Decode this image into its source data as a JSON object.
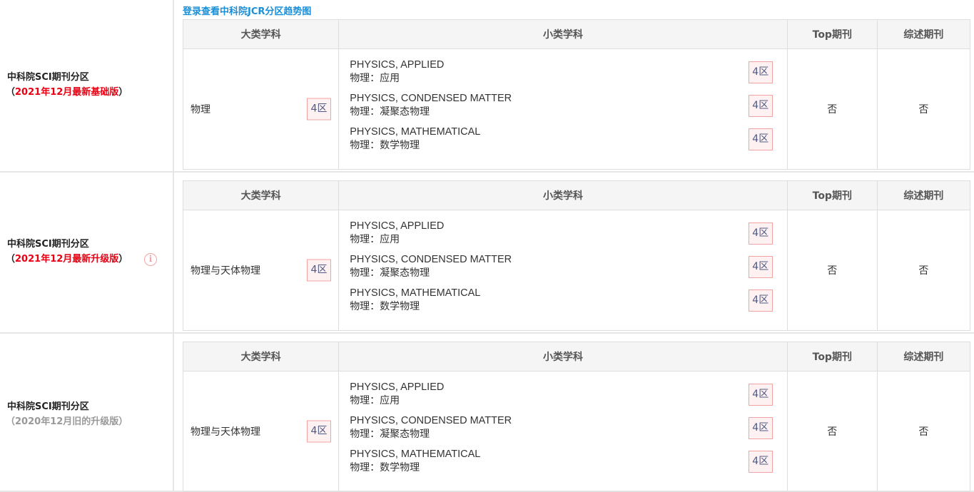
{
  "login_link": "登录查看中科院JCR分区趋势图",
  "headers": {
    "big_category": "大类学科",
    "small_category": "小类学科",
    "top": "Top期刊",
    "review": "综述期刊"
  },
  "sections": [
    {
      "title": "中科院SCI期刊分区",
      "paren_open": "（",
      "version": "2021年12月最新基础版",
      "paren_close": "）",
      "version_color": "red",
      "big_category": "物理",
      "big_zone": "4区",
      "subcategories": [
        {
          "en": "PHYSICS, APPLIED",
          "cn": "物理：应用",
          "zone": "4区"
        },
        {
          "en": "PHYSICS, CONDENSED MATTER",
          "cn": "物理：凝聚态物理",
          "zone": "4区"
        },
        {
          "en": "PHYSICS, MATHEMATICAL",
          "cn": "物理：数学物理",
          "zone": "4区"
        }
      ],
      "top": "否",
      "review": "否"
    },
    {
      "title": "中科院SCI期刊分区",
      "paren_open": "（",
      "version": "2021年12月最新升级版",
      "paren_close": "）",
      "version_color": "red",
      "info_icon": "info-circle-icon",
      "big_category": "物理与天体物理",
      "big_zone": "4区",
      "subcategories": [
        {
          "en": "PHYSICS, APPLIED",
          "cn": "物理：应用",
          "zone": "4区"
        },
        {
          "en": "PHYSICS, CONDENSED MATTER",
          "cn": "物理：凝聚态物理",
          "zone": "4区"
        },
        {
          "en": "PHYSICS, MATHEMATICAL",
          "cn": "物理：数学物理",
          "zone": "4区"
        }
      ],
      "top": "否",
      "review": "否"
    },
    {
      "title": "中科院SCI期刊分区",
      "paren_open": "（",
      "version": "2020年12月旧的升级版",
      "paren_close": "）",
      "version_color": "gray",
      "big_category": "物理与天体物理",
      "big_zone": "4区",
      "subcategories": [
        {
          "en": "PHYSICS, APPLIED",
          "cn": "物理：应用",
          "zone": "4区"
        },
        {
          "en": "PHYSICS, CONDENSED MATTER",
          "cn": "物理：凝聚态物理",
          "zone": "4区"
        },
        {
          "en": "PHYSICS, MATHEMATICAL",
          "cn": "物理：数学物理",
          "zone": "4区"
        }
      ],
      "top": "否",
      "review": "否"
    }
  ],
  "colors": {
    "link": "#1a8fd8",
    "version_red": "#e60012",
    "version_gray": "#999999",
    "badge_border": "#f2a4a4",
    "header_bg": "#f5f5f5"
  }
}
